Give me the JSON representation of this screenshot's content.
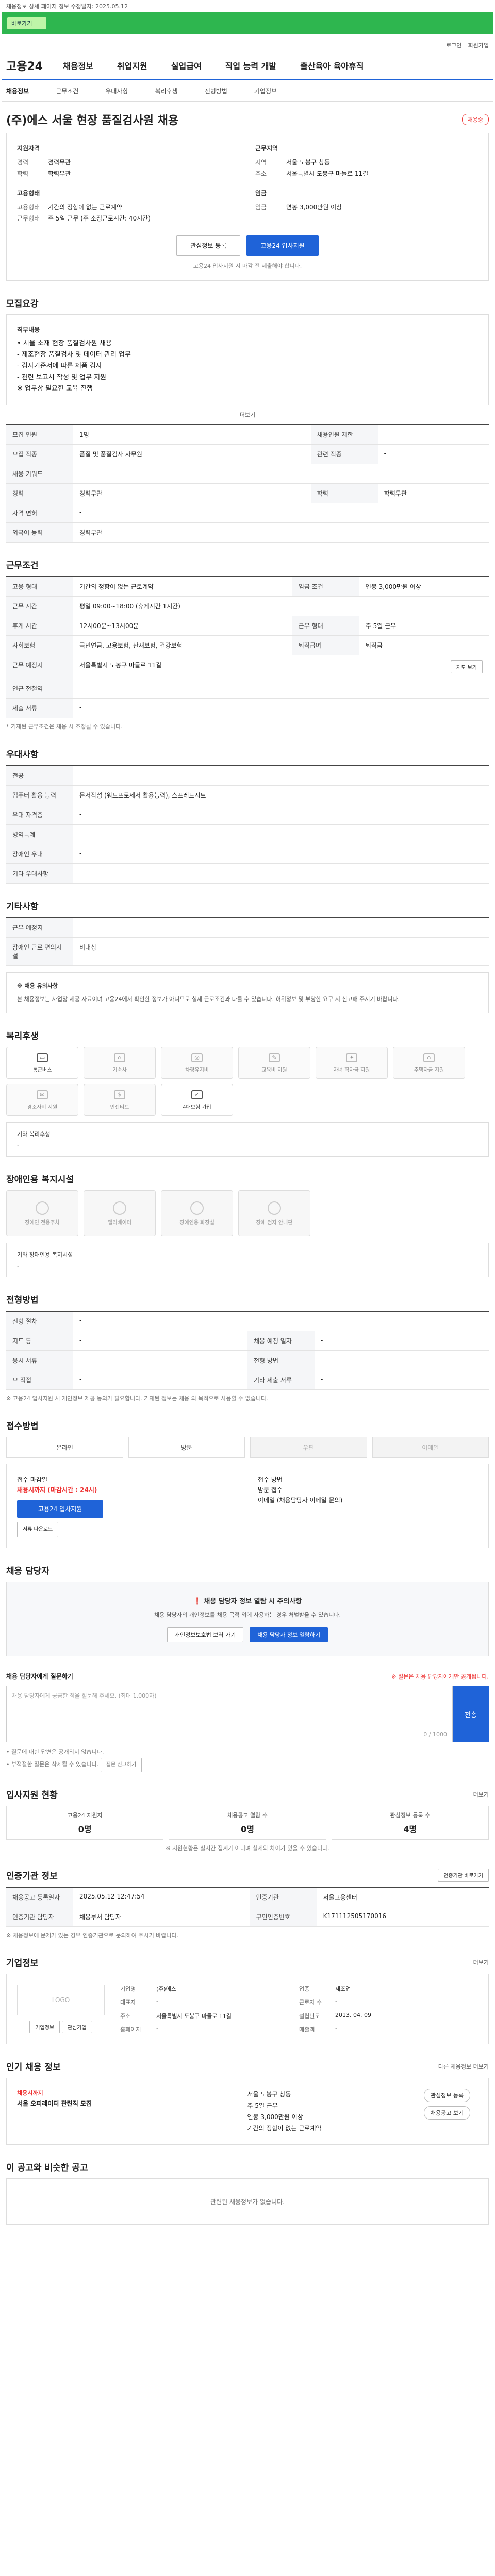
{
  "top_notice": "채용정보 상세 페이지 정보 수정일자: 2025.05.12",
  "banner": {
    "button_label": "바로가기"
  },
  "util": {
    "login": "로그인",
    "join": "회원가입"
  },
  "logo": "고용24",
  "gnb": [
    "채용정보",
    "취업지원",
    "실업급여",
    "직업 능력 개발",
    "출산육아 육아휴직"
  ],
  "subnav": [
    "채용정보",
    "근무조건",
    "우대사항",
    "복리후생",
    "전형방법",
    "기업정보"
  ],
  "job": {
    "title": "(주)에스 서울 현장 품질검사원 채용",
    "badge": "채용중"
  },
  "summary": {
    "left_head": "지원자격",
    "left": [
      {
        "k": "경력",
        "v": "경력무관"
      },
      {
        "k": "학력",
        "v": "학력무관"
      }
    ],
    "right_head": "근무지역",
    "right": [
      {
        "k": "지역",
        "v": "서울 도봉구 창동"
      },
      {
        "k": "주소",
        "v": "서울특별시 도봉구 마들로 11길 "
      }
    ],
    "left2_head": "고용형태",
    "left2": [
      {
        "k": "고용형태",
        "v": "기간의 정함이 없는 근로계약"
      },
      {
        "k": "근무형태",
        "v": "주 5일 근무 (주 소정근로시간: 40시간)"
      }
    ],
    "right2_head": "임금",
    "right2": [
      {
        "k": "임금",
        "v": "연봉 3,000만원 이상"
      }
    ],
    "btn_scrap": "관심정보 등록",
    "btn_apply": "고용24 입사지원",
    "note": "고용24 입사지원 시 마감 전 제출해야 합니다."
  },
  "recruit": {
    "title": "모집요강",
    "desc_head": "직무내용",
    "desc_lines": [
      "• 서울 소재 현장 품질검사원 채용",
      "- 제조현장 품질검사 및 데이터 관리 업무",
      "- 검사기준서에 따른 제품 검사",
      "- 관련 보고서 작성 및 업무 지원",
      "※ 업무상 필요한 교육 진행"
    ],
    "fold": "더보기",
    "rows": [
      {
        "k": "모집 인원",
        "v": "1명",
        "k2": "채용인원 제한",
        "v2": "-"
      },
      {
        "k": "모집 직종",
        "v": "품질 및 품질검사 사무원",
        "k2": "관련 직종",
        "v2": "-"
      },
      {
        "k": "채용 키워드",
        "v": "-",
        "k2": "",
        "v2": ""
      },
      {
        "k": "경력",
        "v": "경력무관",
        "k2": "학력",
        "v2": "학력무관"
      },
      {
        "k": "자격 면허",
        "v": "-",
        "k2": "",
        "v2": ""
      },
      {
        "k": "외국어 능력",
        "v": "경력무관",
        "k2": "",
        "v2": ""
      }
    ]
  },
  "work": {
    "title": "근무조건",
    "rows": [
      {
        "k": "고용 형태",
        "v": "기간의 정함이 없는 근로계약",
        "k2": "임금 조건",
        "v2": "연봉 3,000만원 이상"
      },
      {
        "k": "근무 시간",
        "v": "평일 09:00~18:00 (휴게시간 1시간)",
        "k2": "",
        "v2": ""
      },
      {
        "k": "휴게 시간",
        "v": "12시00분~13시00분",
        "k2": "근무 형태",
        "v2": "주 5일 근무"
      },
      {
        "k": "사회보험",
        "v": "국민연금, 고용보험, 산재보험, 건강보험",
        "k2": "퇴직급여",
        "v2": "퇴직금"
      },
      {
        "k": "근무 예정지",
        "v": "서울특별시 도봉구 마들로 11길",
        "k2": "",
        "v2": ""
      },
      {
        "k": "인근 전철역",
        "v": "-",
        "k2": "",
        "v2": ""
      },
      {
        "k": "제출 서류",
        "v": "-",
        "k2": "",
        "v2": ""
      }
    ],
    "map_btn": "지도 보기",
    "footnote": "* 기재된 근무조건은 채용 시 조정될 수 있습니다."
  },
  "prefer": {
    "title": "우대사항",
    "rows": [
      {
        "k": "전공",
        "v": "-"
      },
      {
        "k": "컴퓨터 활용 능력",
        "v": "문서작성 (워드프로세서 활용능력), 스프레드시트"
      },
      {
        "k": "우대 자격증",
        "v": "-"
      },
      {
        "k": "병역특례",
        "v": "-"
      },
      {
        "k": "장애인 우대",
        "v": "-"
      },
      {
        "k": "기타 우대사항",
        "v": "-"
      }
    ]
  },
  "etc": {
    "title": "기타사항",
    "rows": [
      {
        "k": "근무 예정지",
        "v": "-"
      },
      {
        "k": "장애인 근로 편의시설",
        "v": "비대상"
      }
    ],
    "notice_head": "※ 채용 유의사항",
    "notice": "본 채용정보는 사업장 제공 자료이며 고용24에서 확인한 정보가 아니므로 실제 근로조건과 다를 수 있습니다. 허위정보 및 부당한 요구 시 신고해 주시기 바랍니다."
  },
  "welfare": {
    "title": "복리후생",
    "items": [
      {
        "label": "통근버스",
        "on": true
      },
      {
        "label": "기숙사",
        "on": false
      },
      {
        "label": "차량유지비",
        "on": false
      },
      {
        "label": "교육비 지원",
        "on": false
      },
      {
        "label": "자녀 학자금 지원",
        "on": false
      },
      {
        "label": "주택자금 지원",
        "on": false
      },
      {
        "label": "경조사비 지원",
        "on": false
      },
      {
        "label": "인센티브",
        "on": false
      },
      {
        "label": "4대보험 가입",
        "on": true
      }
    ],
    "other_head": "기타 복리후생",
    "other": "-"
  },
  "disabled": {
    "title": "장애인용 복지시설",
    "items": [
      "장애인 전용주차",
      "엘리베이터",
      "장애인용 화장실",
      "장애 점자 안내판"
    ],
    "other_head": "기타 장애인용 복지시설",
    "other": "-"
  },
  "selection": {
    "title": "전형방법",
    "rows": [
      {
        "k": "전형 절차",
        "v": "-",
        "k2": "",
        "v2": ""
      },
      {
        "k": "지도 등",
        "v": "-",
        "k2": "채용 예정 일자",
        "v2": "-"
      },
      {
        "k": "응시 서류",
        "v": "-",
        "k2": "전형 방법",
        "v2": "-"
      },
      {
        "k": "모 직접",
        "v": "-",
        "k2": "기타 제출 서류",
        "v2": "-"
      }
    ],
    "notes": "※ 고용24 입사지원 시 개인정보 제공 동의가 필요합니다. 기재된 정보는 채용 외 목적으로 사용할 수 없습니다."
  },
  "method": {
    "title": "접수방법",
    "items": [
      {
        "label": "온라인",
        "on": true
      },
      {
        "label": "방문",
        "on": true
      },
      {
        "label": "우편",
        "on": false
      },
      {
        "label": "이메일",
        "on": false
      }
    ],
    "deadline_head": "접수 마감일",
    "deadline": "채용시까지 (마감시간 : 24시)",
    "apply_btn": "고용24 입사지원",
    "method_head": "접수 방법",
    "method_lines": [
      "방문 접수",
      "이메일 (채용담당자 이메일 문의)"
    ],
    "docs_btn": "서류 다운로드"
  },
  "contact": {
    "title": "채용 담당자",
    "warn": "채용 담당자 정보 열람 시 주의사항",
    "sub": "채용 담당자의 개인정보를 채용 목적 외에 사용하는 경우 처벌받을 수 있습니다.",
    "btn1": "개인정보보호법 보러 가기",
    "btn2": "채용 담당자 정보 열람하기"
  },
  "qa": {
    "title": "채용 담당자에게 질문하기",
    "note": "※ 질문은 채용 담당자에게만 공개됩니다.",
    "placeholder": "채용 담당자에게 궁금한 점을 질문해 주세요. (최대 1,000자)",
    "counter": "0 / 1000",
    "send": "전송",
    "footnotes": [
      "• 질문에 대한 답변은 공개되지 않습니다.",
      "• 부적절한 질문은 삭제될 수 있습니다."
    ],
    "report_btn": "질문 신고하기"
  },
  "status": {
    "title": "입사지원 현황",
    "more": "더보기",
    "items": [
      {
        "label": "고용24 지원자",
        "n": "0명"
      },
      {
        "label": "채용공고 열람 수",
        "n": "0명"
      },
      {
        "label": "관심정보 등록 수",
        "n": "4명"
      }
    ],
    "note": "※ 지원현황은 실시간 집계가 아니며 실제와 차이가 있을 수 있습니다."
  },
  "reg": {
    "title": "인증기관 정보",
    "more_btn": "인증기관 바로가기",
    "rows": [
      {
        "k": "채용공고 등록일자",
        "v": "2025.05.12 12:47:54",
        "k2": "인증기관",
        "v2": "서울고용센터"
      },
      {
        "k": "인증기관 담당자",
        "v": "채용부서 담당자",
        "k2": "구인인증번호",
        "v2": "K171112505170016"
      }
    ],
    "notes": "※ 채용정보에 문제가 있는 경우 인증기관으로 문의하여 주시기 바랍니다."
  },
  "corp": {
    "title": "기업정보",
    "more": "더보기",
    "logo_ph": "LOGO",
    "btn1": "기업정보",
    "btn2": "관심기업",
    "fields": [
      {
        "k": "기업명",
        "v": "(주)에스"
      },
      {
        "k": "업종",
        "v": "제조업"
      },
      {
        "k": "대표자",
        "v": "-"
      },
      {
        "k": "근로자 수",
        "v": "-"
      },
      {
        "k": "주소",
        "v": "서울특별시 도봉구 마들로 11길"
      },
      {
        "k": "설립년도",
        "v": "2013. 04. 09"
      },
      {
        "k": "홈페이지",
        "v": "-"
      },
      {
        "k": "매출액",
        "v": "-"
      }
    ]
  },
  "rec": {
    "title": "인기 채용 정보",
    "more": "다른 채용정보 더보기",
    "card_badge": "채용시까지",
    "card_title": "서울 오피레이터 관련직 모집",
    "lines": [
      "서울 도봉구 창동",
      "주 5일 근무",
      "연봉 3,000만원 이상",
      "기간의 정함이 없는 근로계약"
    ],
    "pill1": "관심정보 등록",
    "pill2": "채용공고 보기"
  },
  "similar": {
    "title": "이 공고와 비슷한 공고",
    "empty": "관련된 채용정보가 없습니다."
  }
}
